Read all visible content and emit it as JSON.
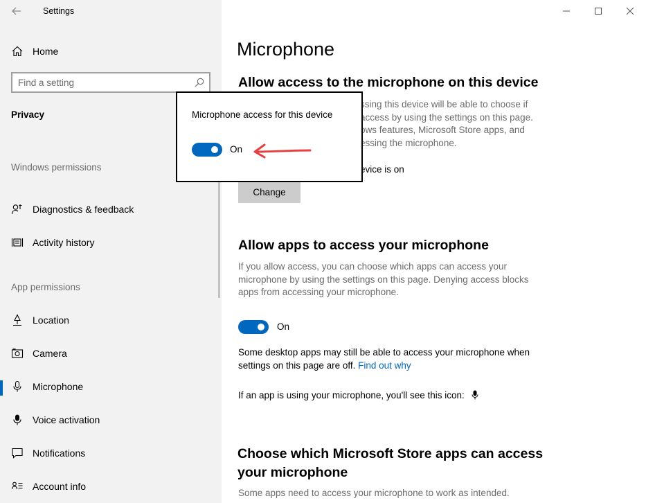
{
  "window": {
    "title": "Settings",
    "controls": [
      "minimize-icon",
      "maximize-icon",
      "close-icon"
    ]
  },
  "sidebar": {
    "home_label": "Home",
    "search_placeholder": "Find a setting",
    "current_section": "Privacy",
    "groups": {
      "windows_permissions": "Windows permissions",
      "app_permissions": "App permissions"
    },
    "items": [
      {
        "label": "Diagnostics & feedback",
        "icon": "diagnostics-icon"
      },
      {
        "label": "Activity history",
        "icon": "activity-history-icon"
      },
      {
        "label": "Location",
        "icon": "location-icon"
      },
      {
        "label": "Camera",
        "icon": "camera-icon"
      },
      {
        "label": "Microphone",
        "icon": "microphone-icon",
        "selected": true
      },
      {
        "label": "Voice activation",
        "icon": "voice-activation-icon"
      },
      {
        "label": "Notifications",
        "icon": "notifications-icon"
      },
      {
        "label": "Account info",
        "icon": "account-info-icon"
      }
    ]
  },
  "main": {
    "title": "Microphone",
    "device_section": {
      "heading": "Allow access to the microphone on this device",
      "desc_line1": "ssing this device will be able to choose if",
      "desc_line2": "access by using the settings on this page.",
      "desc_line3": "ows features, Microsoft Store apps, and",
      "desc_line4": "essing the microphone.",
      "status": "evice is on",
      "change_button": "Change"
    },
    "apps_section": {
      "heading": "Allow apps to access your microphone",
      "desc": "If you allow access, you can choose which apps can access your microphone by using the settings on this page. Denying access blocks apps from accessing your microphone.",
      "toggle_state": "On",
      "note": "Some desktop apps may still be able to access your microphone when settings on this page are off.",
      "note_link": "Find out why",
      "icon_note": "If an app is using your microphone, you'll see this icon:"
    },
    "store_section": {
      "heading_line1": "Choose which Microsoft Store apps can access",
      "heading_line2": "your microphone",
      "desc_partial": "Some apps need to access your microphone to work as intended."
    }
  },
  "popup": {
    "title": "Microphone access for this device",
    "toggle_state": "On"
  },
  "colors": {
    "accent": "#0067c0",
    "arrow": "#e84040",
    "sidebar_bg": "#f2f2f2"
  }
}
